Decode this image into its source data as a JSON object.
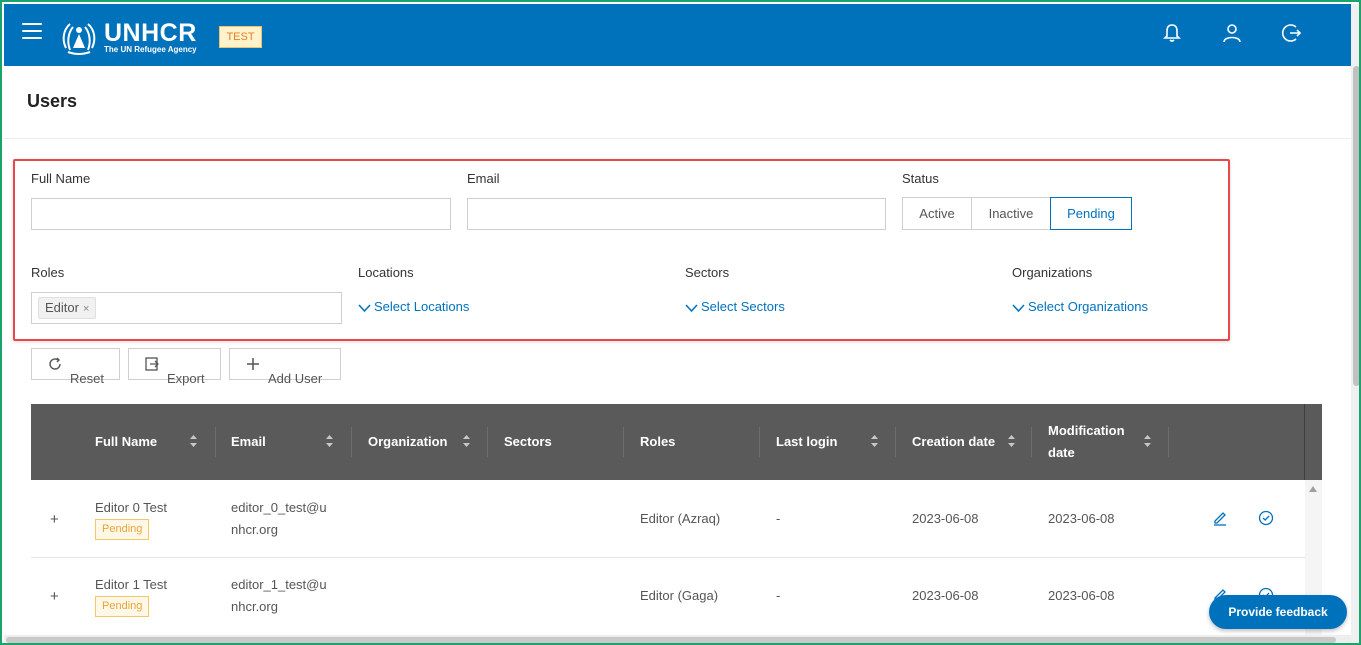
{
  "header": {
    "brand": "UNHCR",
    "brand_sub": "The UN Refugee Agency",
    "env_badge": "TEST",
    "icons": [
      "menu-icon",
      "bell-icon",
      "user-icon",
      "logout-icon"
    ],
    "brand_color": "#0072bc"
  },
  "page": {
    "title": "Users"
  },
  "filters": {
    "full_name": {
      "label": "Full Name",
      "value": "",
      "placeholder": ""
    },
    "email": {
      "label": "Email",
      "value": "",
      "placeholder": ""
    },
    "status": {
      "label": "Status",
      "options": [
        "Active",
        "Inactive",
        "Pending"
      ],
      "selected": "Pending"
    },
    "roles": {
      "label": "Roles",
      "tags": [
        "Editor"
      ]
    },
    "locations": {
      "label": "Locations",
      "link": "Select Locations"
    },
    "sectors": {
      "label": "Sectors",
      "link": "Select Sectors"
    },
    "organizations": {
      "label": "Organizations",
      "link": "Select Organizations"
    },
    "highlight_color": "#e8474c"
  },
  "toolbar": {
    "reset": "Reset",
    "export": "Export",
    "add_user": "Add User"
  },
  "table": {
    "columns": [
      {
        "line1": "Full Name",
        "line2": ""
      },
      {
        "line1": "Email",
        "line2": ""
      },
      {
        "line1": "Organization",
        "line2": ""
      },
      {
        "line1": "Sectors",
        "line2": ""
      },
      {
        "line1": "Roles",
        "line2": ""
      },
      {
        "line1": "Last login",
        "line2": ""
      },
      {
        "line1": "Creation date",
        "line2": ""
      },
      {
        "line1": "Modification",
        "line2": "date"
      }
    ],
    "rows": [
      {
        "expand": "+",
        "full_name": "Editor 0 Test",
        "status": "Pending",
        "email_line1": "editor_0_test@u",
        "email_line2": "nhcr.org",
        "organization": "",
        "sectors": "",
        "roles": "Editor (Azraq)",
        "last_login": "-",
        "creation_date": "2023-06-08",
        "modification_date": "2023-06-08"
      },
      {
        "expand": "+",
        "full_name": "Editor 1 Test",
        "status": "Pending",
        "email_line1": "editor_1_test@u",
        "email_line2": "nhcr.org",
        "organization": "",
        "sectors": "",
        "roles": "Editor (Gaga)",
        "last_login": "-",
        "creation_date": "2023-06-08",
        "modification_date": "2023-06-08"
      }
    ],
    "row_actions": [
      "edit-icon",
      "approve-icon"
    ],
    "pending_color": "#e8a33a"
  },
  "feedback": {
    "label": "Provide feedback"
  }
}
